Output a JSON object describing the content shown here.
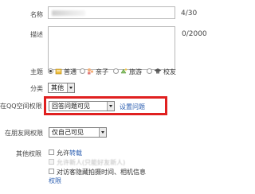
{
  "form": {
    "name": {
      "label": "名称",
      "counter": "4/30"
    },
    "description": {
      "label": "描述",
      "counter": "0/2000"
    },
    "theme": {
      "label": "主题",
      "options": [
        {
          "label": "普通",
          "selected": true,
          "icon": "normal-icon"
        },
        {
          "label": "亲子",
          "selected": false,
          "icon": "family-icon"
        },
        {
          "label": "旅游",
          "selected": false,
          "icon": "travel-icon"
        },
        {
          "label": "校友",
          "selected": false,
          "icon": "alumni-icon"
        }
      ]
    },
    "category": {
      "label": "分类",
      "value": "其他"
    },
    "qzone_permission": {
      "label": "在QQ空间权限",
      "value": "回答问题可见",
      "link": "设置问题",
      "highlight_color": "#e02020"
    },
    "friend_permission": {
      "label": "在朋友网权限",
      "value": "仅自己可见"
    },
    "other_permission": {
      "label": "其他权限",
      "allow_repost": {
        "text": "允许",
        "link": "转载"
      },
      "allow_members": {
        "text": "允许新人(只能好友新人)"
      },
      "reveal_info": {
        "text": "对访客隐藏拍摄时间、相机信息",
        "link": "权限"
      }
    }
  },
  "colors": {
    "link": "#2a5db0",
    "highlight": "#e02020"
  }
}
